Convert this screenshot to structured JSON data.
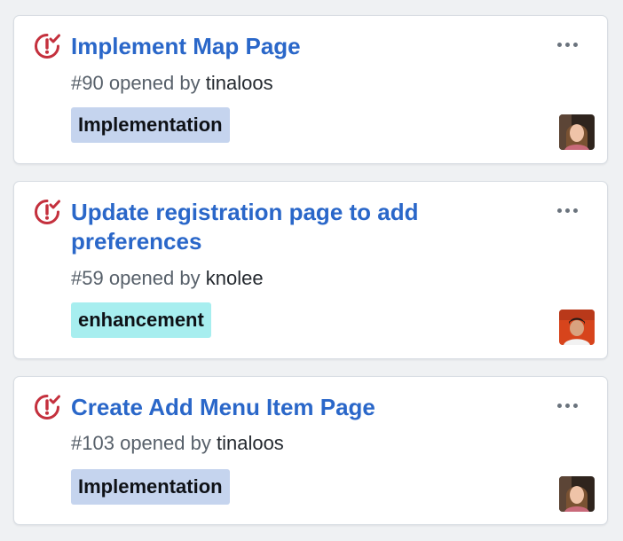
{
  "colors": {
    "background": "#eff1f3",
    "card": "#ffffff",
    "title_link": "#2a67c9",
    "issue_icon": "#c4303d",
    "meta_text": "#57606a",
    "author_text": "#24292f"
  },
  "cards": [
    {
      "icon": "issue-opened-icon",
      "title": "Implement Map Page",
      "number": "#90",
      "opened_by_text": "opened by",
      "author": "tinaloos",
      "label": {
        "text": "Implementation",
        "color": "#c5d4ee"
      },
      "avatar": "tinaloos-avatar"
    },
    {
      "icon": "issue-opened-icon",
      "title": "Update registration page to add preferences",
      "number": "#59",
      "opened_by_text": "opened by",
      "author": "knolee",
      "label": {
        "text": "enhancement",
        "color": "#a7eeef"
      },
      "avatar": "knolee-avatar"
    },
    {
      "icon": "issue-opened-icon",
      "title": "Create Add Menu Item Page",
      "number": "#103",
      "opened_by_text": "opened by",
      "author": "tinaloos",
      "label": {
        "text": "Implementation",
        "color": "#c5d4ee"
      },
      "avatar": "tinaloos-avatar"
    }
  ]
}
